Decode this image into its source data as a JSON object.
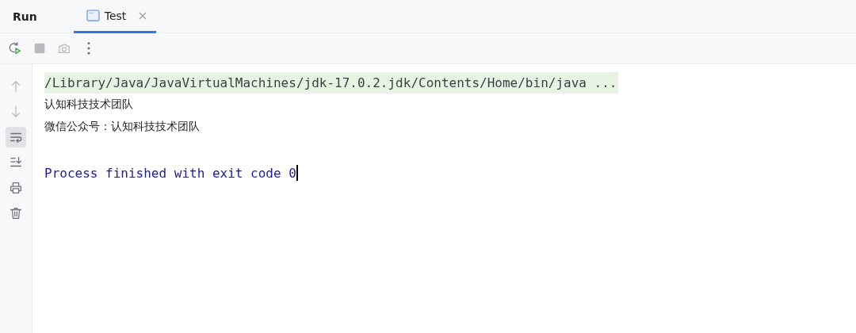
{
  "panel": {
    "title": "Run"
  },
  "tabs": [
    {
      "label": "Test",
      "selected": true,
      "closable": true
    }
  ],
  "toolbar": [
    {
      "kind": "rerun",
      "disabled": false
    },
    {
      "kind": "stop",
      "disabled": true
    },
    {
      "kind": "screenshot",
      "disabled": true
    },
    {
      "kind": "more",
      "disabled": false
    }
  ],
  "side_tools": [
    {
      "kind": "up",
      "disabled": true,
      "on": false
    },
    {
      "kind": "down",
      "disabled": true,
      "on": false
    },
    {
      "kind": "soft-wrap",
      "disabled": false,
      "on": true
    },
    {
      "kind": "scroll-end",
      "disabled": false,
      "on": false
    },
    {
      "kind": "print",
      "disabled": false,
      "on": false
    },
    {
      "kind": "trash",
      "disabled": false,
      "on": false
    }
  ],
  "console": {
    "lines": [
      {
        "kind": "command",
        "text": "/Library/Java/JavaVirtualMachines/jdk-17.0.2.jdk/Contents/Home/bin/java ..."
      },
      {
        "kind": "stdout",
        "text": "认知科技技术团队"
      },
      {
        "kind": "stdout",
        "text": "微信公众号：认知科技技术团队"
      },
      {
        "kind": "blank"
      },
      {
        "kind": "system",
        "text": "Process finished with exit code 0",
        "cursor": true
      }
    ]
  }
}
